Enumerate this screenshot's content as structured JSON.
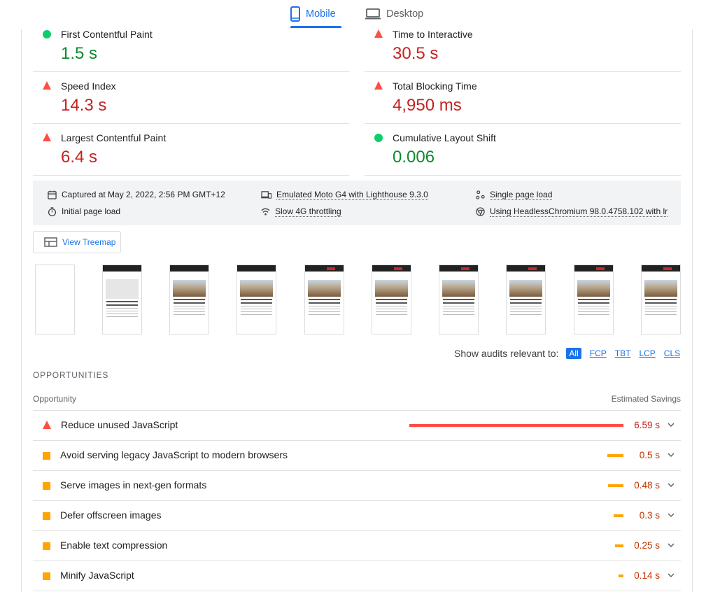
{
  "tabs": [
    {
      "label": "Mobile",
      "active": true
    },
    {
      "label": "Desktop",
      "active": false
    }
  ],
  "metrics": [
    {
      "label": "First Contentful Paint",
      "value": "1.5 s",
      "status": "pass"
    },
    {
      "label": "Time to Interactive",
      "value": "30.5 s",
      "status": "fail"
    },
    {
      "label": "Speed Index",
      "value": "14.3 s",
      "status": "fail"
    },
    {
      "label": "Total Blocking Time",
      "value": "4,950 ms",
      "status": "fail"
    },
    {
      "label": "Largest Contentful Paint",
      "value": "6.4 s",
      "status": "fail"
    },
    {
      "label": "Cumulative Layout Shift",
      "value": "0.006",
      "status": "pass"
    }
  ],
  "info": {
    "captured": "Captured at May 2, 2022, 2:56 PM GMT+12",
    "initial_load": "Initial page load",
    "device": "Emulated Moto G4 with Lighthouse 9.3.0",
    "throttling": "Slow 4G throttling",
    "session": "Single page load",
    "browser": "Using HeadlessChromium 98.0.4758.102 with lr"
  },
  "treemap": {
    "label": "View Treemap"
  },
  "filmstrip_frames": 10,
  "filter": {
    "label": "Show audits relevant to:",
    "chips": [
      "All",
      "FCP",
      "TBT",
      "LCP",
      "CLS"
    ],
    "active": "All"
  },
  "opportunities": {
    "section_title": "OPPORTUNITIES",
    "col_left": "Opportunity",
    "col_right": "Estimated Savings",
    "items": [
      {
        "title": "Reduce unused JavaScript",
        "savings": "6.59 s",
        "savings_s": 6.59,
        "severity": "fail"
      },
      {
        "title": "Avoid serving legacy JavaScript to modern browsers",
        "savings": "0.5 s",
        "savings_s": 0.5,
        "severity": "average"
      },
      {
        "title": "Serve images in next-gen formats",
        "savings": "0.48 s",
        "savings_s": 0.48,
        "severity": "average"
      },
      {
        "title": "Defer offscreen images",
        "savings": "0.3 s",
        "savings_s": 0.3,
        "severity": "average"
      },
      {
        "title": "Enable text compression",
        "savings": "0.25 s",
        "savings_s": 0.25,
        "severity": "average"
      },
      {
        "title": "Minify JavaScript",
        "savings": "0.14 s",
        "savings_s": 0.14,
        "severity": "average"
      }
    ]
  },
  "colors": {
    "accent": "#1a73e8",
    "pass": "#0cce6b",
    "fail": "#ff4e42",
    "average": "#ffa400"
  }
}
